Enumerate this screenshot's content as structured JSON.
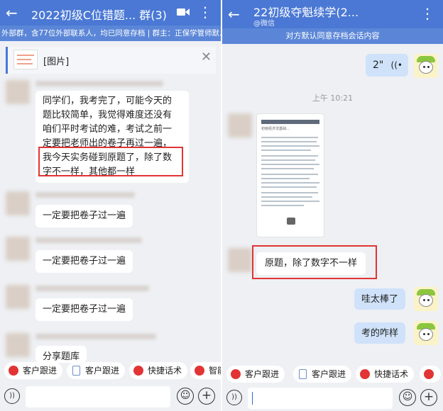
{
  "left": {
    "title": "2022初级C位错题... 群(3)",
    "notice": "外部群，含77位外部联系人，均已同意存档 | 群主：正保学管师默...",
    "quote_label": "[图片]",
    "msg_1": [
      "同学们，我考完了，可能今天的",
      "题比较简单，我觉得难度还没有",
      "咱们平时考试的难，考试之前一",
      "定要把老师出的卷子再过一遍，",
      "我今天实务碰到原题了，除了数",
      "字不一样，其他都一样"
    ],
    "msg_2": "一定要把卷子过一遍",
    "msg_3": "一定要把卷子过一遍",
    "msg_4": "一定要把卷子过一遍",
    "msg_5": "分享题库",
    "tabs": [
      "客户跟进",
      "客户跟进",
      "快捷话术",
      "智能"
    ]
  },
  "right": {
    "title": "22初级夺魁续学(2...",
    "subtitle": "@微信",
    "notice": "对方默认同意存档会话内容",
    "voice": "2\"",
    "time": "上午 10:21",
    "doc_title": "初级经济法基础...",
    "msg_reply": "原题，除了数字不一样",
    "msg_mine_1": "哇太棒了",
    "msg_mine_2": "考的咋样",
    "tabs": [
      "客户跟进",
      "客户跟进",
      "快捷话术"
    ]
  },
  "colors": {
    "header": "#4a78d4",
    "highlight_box": "#e23434",
    "mine_bubble": "#cfe2fa"
  },
  "icons": [
    "back-arrow-icon",
    "video-call-icon",
    "more-vertical-icon",
    "close-icon",
    "voice-icon",
    "emoji-icon",
    "plus-icon",
    "customer-follow-icon",
    "document-icon",
    "quick-reply-icon"
  ]
}
